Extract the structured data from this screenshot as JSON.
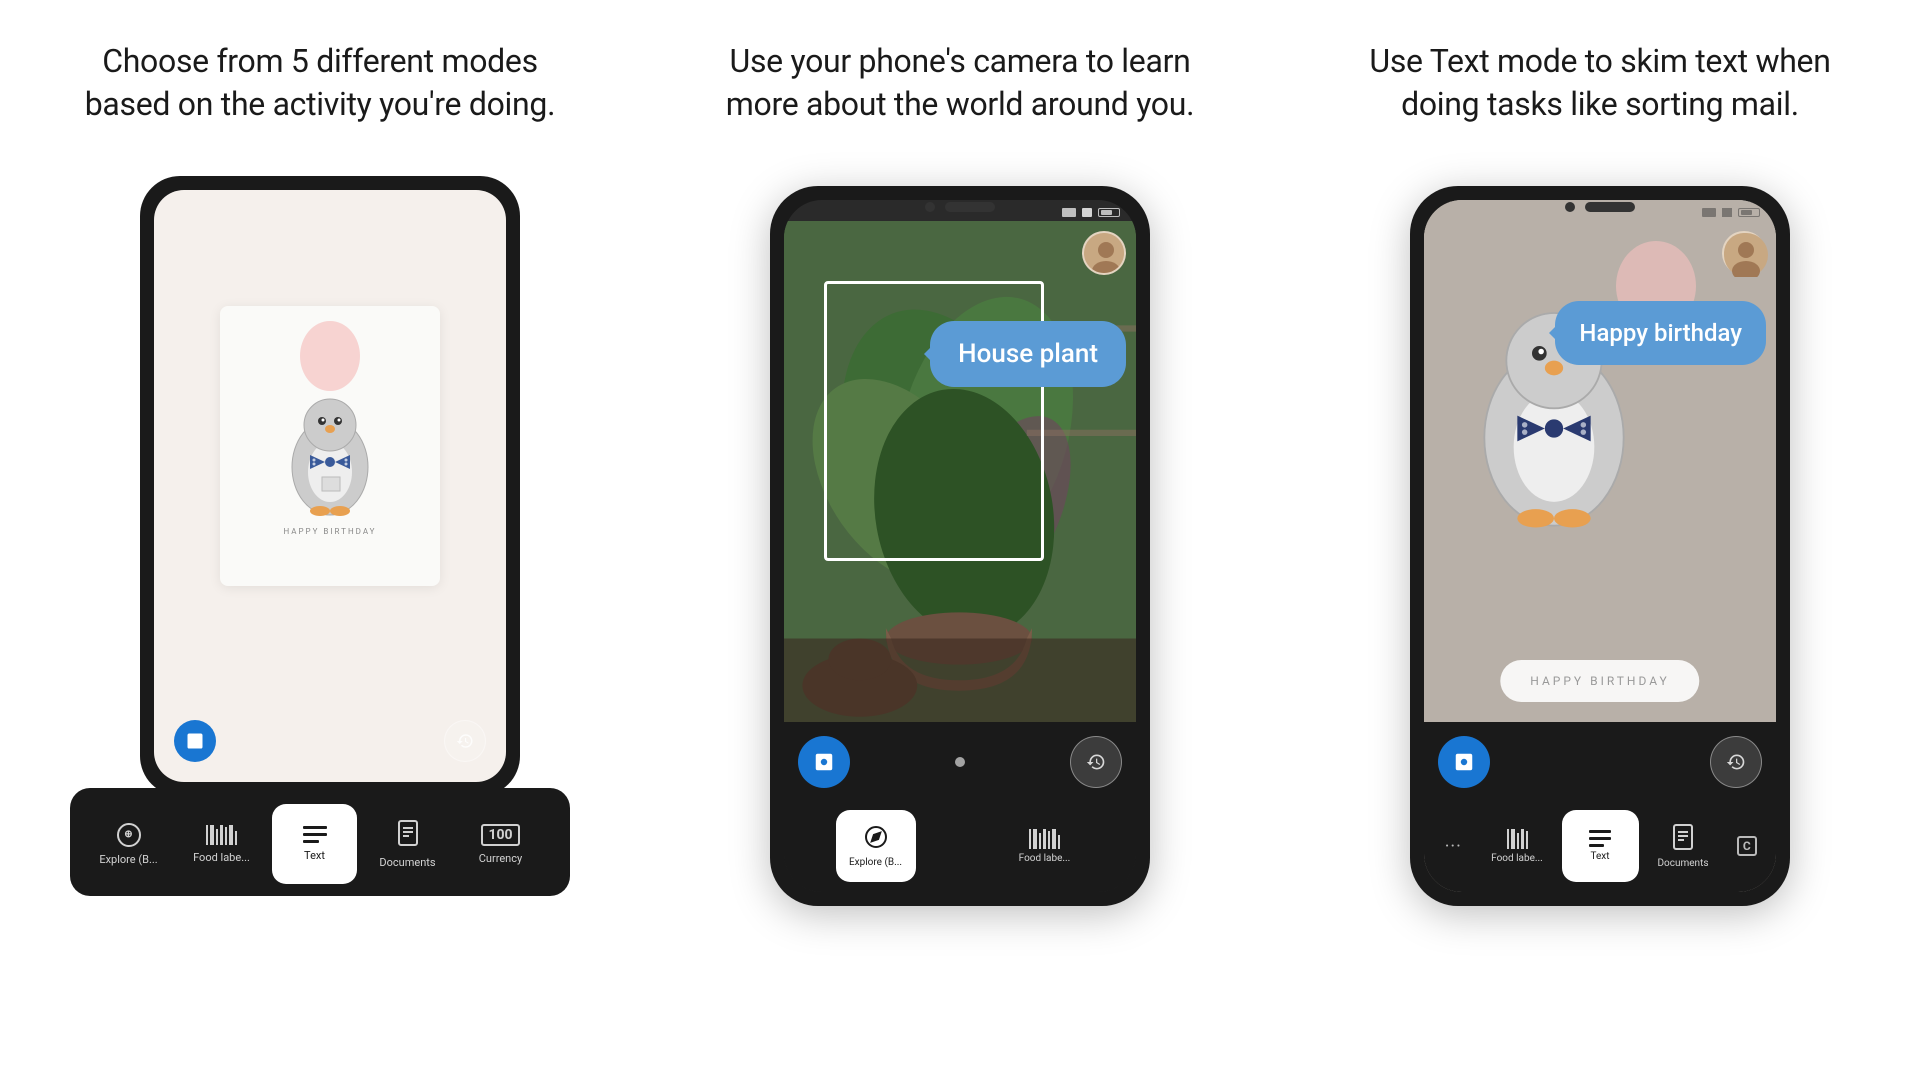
{
  "columns": [
    {
      "id": "col1",
      "headline": "Choose from 5 different modes based on the activity you're doing.",
      "type": "phone1"
    },
    {
      "id": "col2",
      "headline": "Use your phone's camera to learn more about the world around you.",
      "type": "phone2",
      "detection_label": "House plant"
    },
    {
      "id": "col3",
      "headline": "Use Text mode to skim text when doing tasks like sorting mail.",
      "type": "phone3",
      "detection_label": "Happy birthday"
    }
  ],
  "phone1": {
    "penguin_card_text": "HAPPY BIRTHDAY",
    "tabs": [
      {
        "id": "explore",
        "label": "Explore (B...",
        "icon": "compass",
        "active": false
      },
      {
        "id": "food",
        "label": "Food labe...",
        "icon": "barcode",
        "active": false
      },
      {
        "id": "text",
        "label": "Text",
        "icon": "text",
        "active": true
      },
      {
        "id": "documents",
        "label": "Documents",
        "icon": "document",
        "active": false
      },
      {
        "id": "currency",
        "label": "Currency",
        "icon": "currency",
        "active": false
      }
    ]
  },
  "phone2": {
    "detection_label": "House plant",
    "tabs": [
      {
        "id": "explore",
        "label": "Explore (B...",
        "icon": "compass",
        "active": true
      },
      {
        "id": "food",
        "label": "Food labe...",
        "icon": "barcode",
        "active": false
      }
    ]
  },
  "phone3": {
    "detection_label": "Happy birthday",
    "birthday_btn": "HAPPY BIRTHDAY",
    "tabs": [
      {
        "id": "dots",
        "label": "...",
        "icon": "dots",
        "active": false
      },
      {
        "id": "food",
        "label": "Food labe...",
        "icon": "barcode",
        "active": false
      },
      {
        "id": "text",
        "label": "Text",
        "icon": "text",
        "active": true
      },
      {
        "id": "documents",
        "label": "Documents",
        "icon": "document",
        "active": false
      },
      {
        "id": "currency",
        "label": "C",
        "icon": "currency",
        "active": false
      }
    ]
  },
  "colors": {
    "accent_blue": "#1976d2",
    "bubble_blue": "#5b9bd5",
    "phone_bg": "#1a1a1a",
    "tab_active_bg": "#ffffff",
    "tab_active_text": "#1a1a1a",
    "tab_inactive_text": "rgba(255,255,255,0.8)"
  }
}
